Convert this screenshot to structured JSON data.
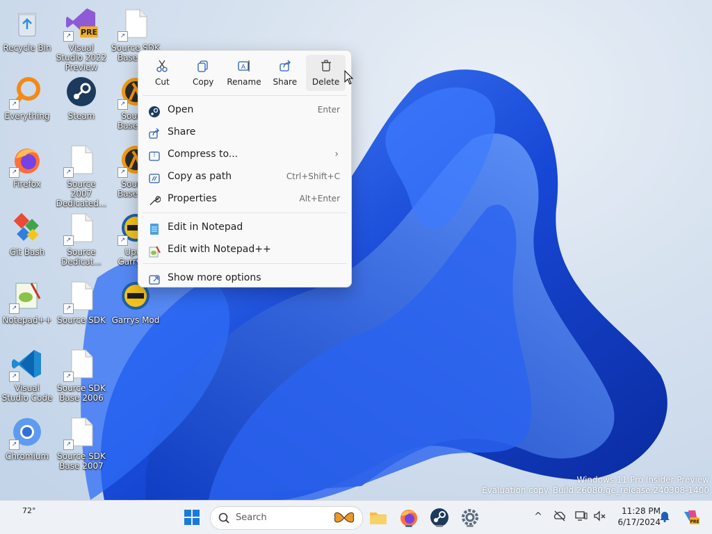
{
  "desktop_icons": [
    {
      "label": "Recycle Bin"
    },
    {
      "label": "Everything"
    },
    {
      "label": "Firefox"
    },
    {
      "label": "Git Bash"
    },
    {
      "label": "Notepad++"
    },
    {
      "label": "Visual Studio Code"
    },
    {
      "label": "Chromium"
    },
    {
      "label": "Visual Studio 2022 Preview",
      "badge": "PRE"
    },
    {
      "label": "Steam"
    },
    {
      "label": "Source 2007 Dedicated..."
    },
    {
      "label": "Source Dedicat..."
    },
    {
      "label": "Source SDK"
    },
    {
      "label": "Source SDK Base 2006"
    },
    {
      "label": "Source SDK Base 2007"
    },
    {
      "label": "Source SDK Base 2..."
    },
    {
      "label": "Source Base 2..."
    },
    {
      "label": "Source Base 2..."
    },
    {
      "label": "Upda Garrys..."
    },
    {
      "label": "Garrys Mod"
    }
  ],
  "context_menu": {
    "top_actions": [
      {
        "label": "Cut",
        "icon": "scissors-icon"
      },
      {
        "label": "Copy",
        "icon": "copy-icon"
      },
      {
        "label": "Rename",
        "icon": "rename-icon"
      },
      {
        "label": "Share",
        "icon": "share-icon"
      },
      {
        "label": "Delete",
        "icon": "trash-icon"
      }
    ],
    "items": [
      {
        "label": "Open",
        "shortcut": "Enter",
        "icon": "steam-icon"
      },
      {
        "label": "Share",
        "shortcut": "",
        "icon": "share-icon"
      },
      {
        "label": "Compress to...",
        "shortcut": "",
        "icon": "zip-icon",
        "submenu": true
      },
      {
        "label": "Copy as path",
        "shortcut": "Ctrl+Shift+C",
        "icon": "path-icon"
      },
      {
        "label": "Properties",
        "shortcut": "Alt+Enter",
        "icon": "wrench-icon"
      }
    ],
    "items2": [
      {
        "label": "Edit in Notepad",
        "icon": "notepad-icon"
      },
      {
        "label": "Edit with Notepad++",
        "icon": "notepadpp-icon"
      }
    ],
    "items3": [
      {
        "label": "Show more options",
        "icon": "more-options-icon"
      }
    ],
    "submenu_glyph": "›"
  },
  "watermark": {
    "line1": "Windows 11 Pro Insider Preview",
    "line2": "Evaluation copy. Build 26080.ge_release.240308-1400"
  },
  "taskbar": {
    "weather_temp": "72°",
    "search_placeholder": "Search",
    "time": "11:28 PM",
    "date": "6/17/2024",
    "tray_chevron": "^"
  },
  "colors": {
    "accent": "#2a6fd6",
    "bloom": "#1a4fd8"
  }
}
